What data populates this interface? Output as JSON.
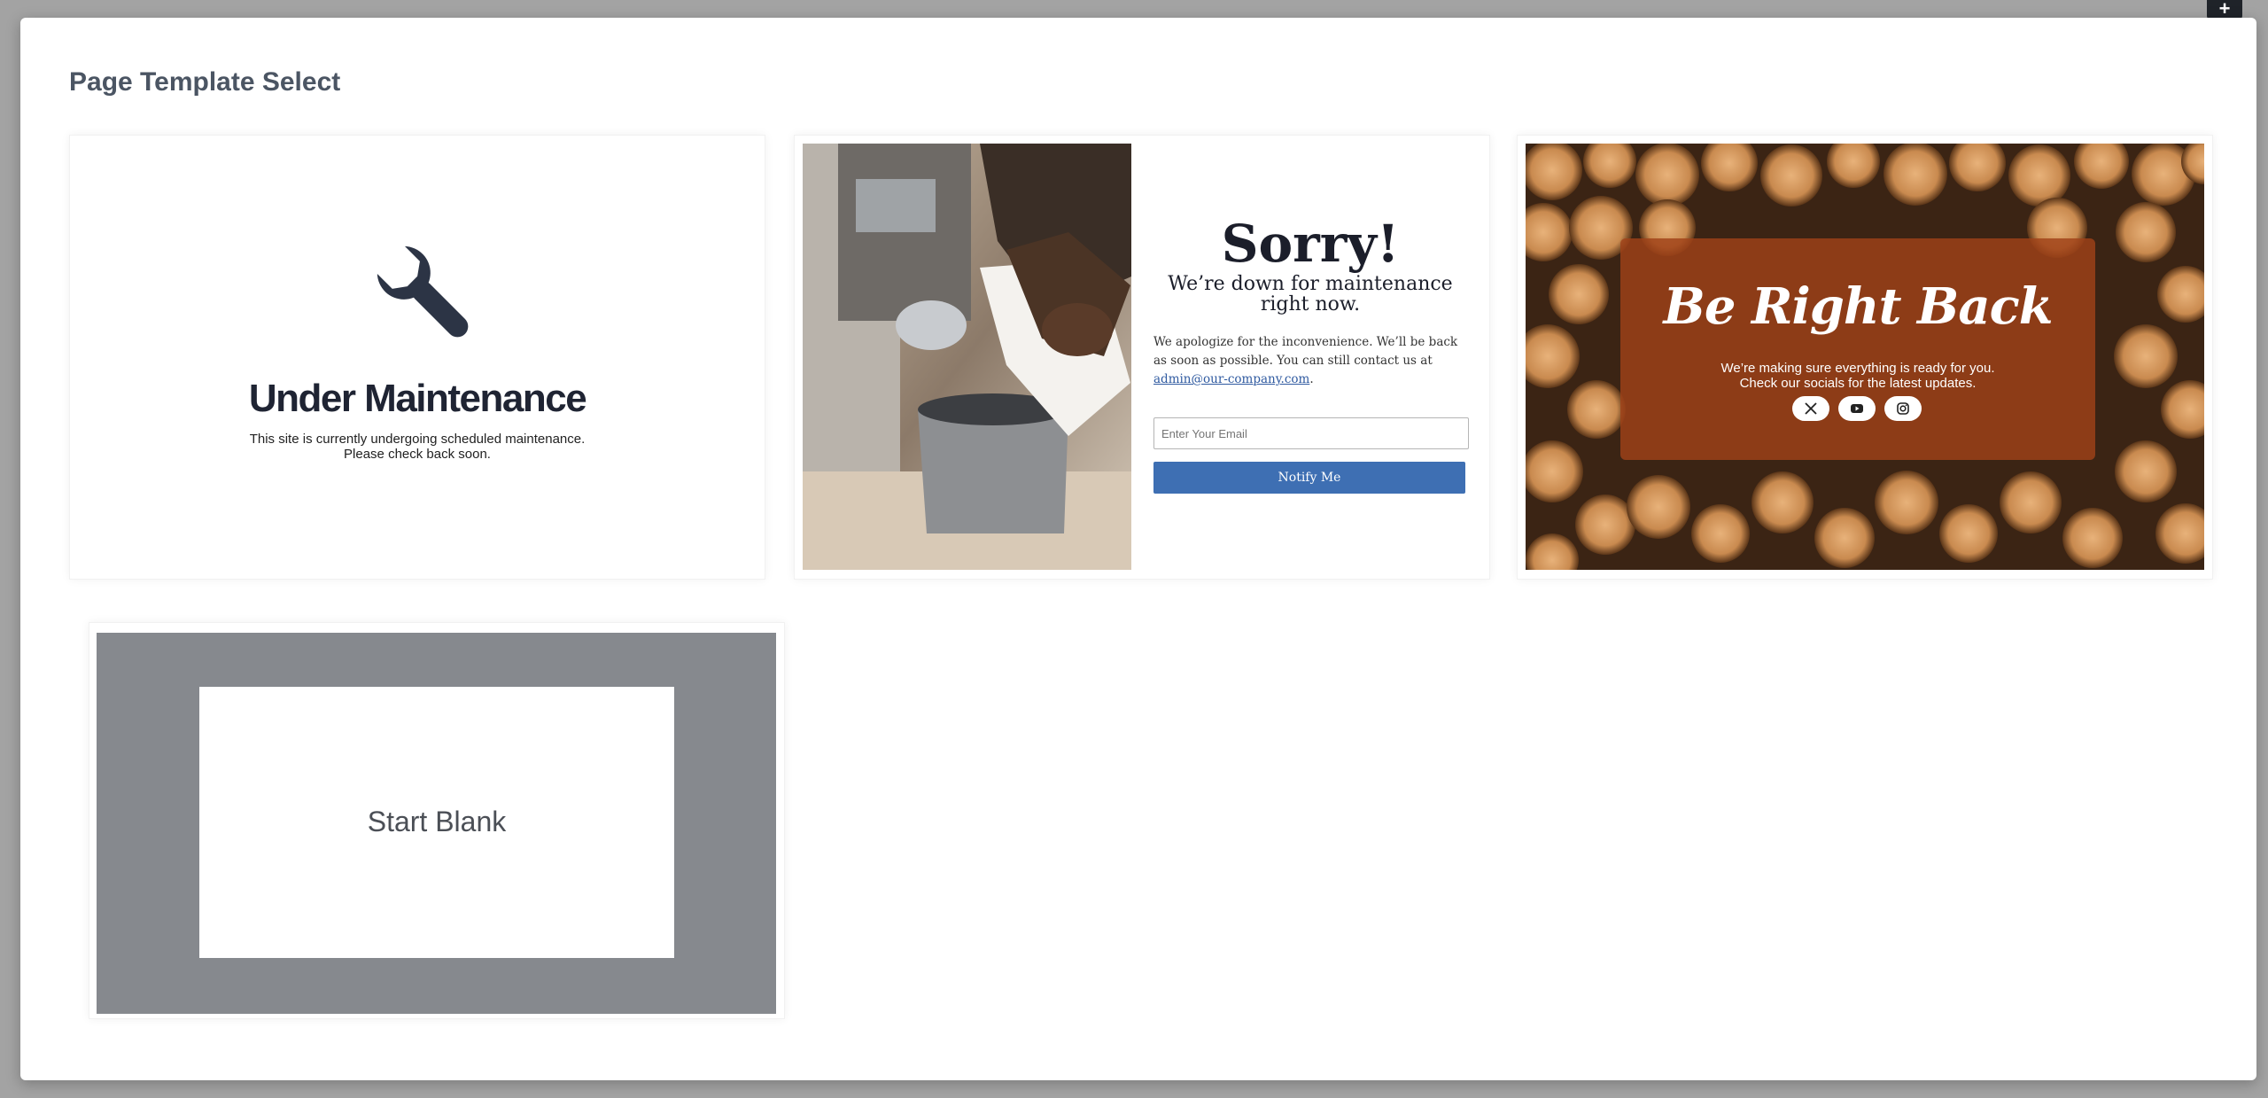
{
  "modal": {
    "title": "Page Template Select",
    "close_icon": "plus-icon"
  },
  "templates": [
    {
      "name": "Under Maintenance",
      "icon": "wrench-icon",
      "title": "Under Maintenance",
      "text_line1": "This site is currently undergoing scheduled maintenance.",
      "text_line2": "Please check back soon."
    },
    {
      "name": "Sorry",
      "title": "Sorry!",
      "subtitle_line1": "We’re down for maintenance",
      "subtitle_line2": "right now.",
      "body": "We apologize for the inconvenience. We’ll be back as soon as possible. You can still contact us at",
      "link": "admin@our-company.com",
      "email_placeholder": "Enter Your Email",
      "button_label": "Notify Me",
      "button_color": "#3e6fb3"
    },
    {
      "name": "Be Right Back",
      "title": "Be Right Back",
      "text_line1": "We’re making sure everything is ready for you.",
      "text_line2": "Check our socials for the latest updates.",
      "socials": [
        "x-icon",
        "youtube-icon",
        "instagram-icon"
      ],
      "overlay_color": "#a04218"
    },
    {
      "name": "Start Blank",
      "label": "Start Blank"
    }
  ]
}
